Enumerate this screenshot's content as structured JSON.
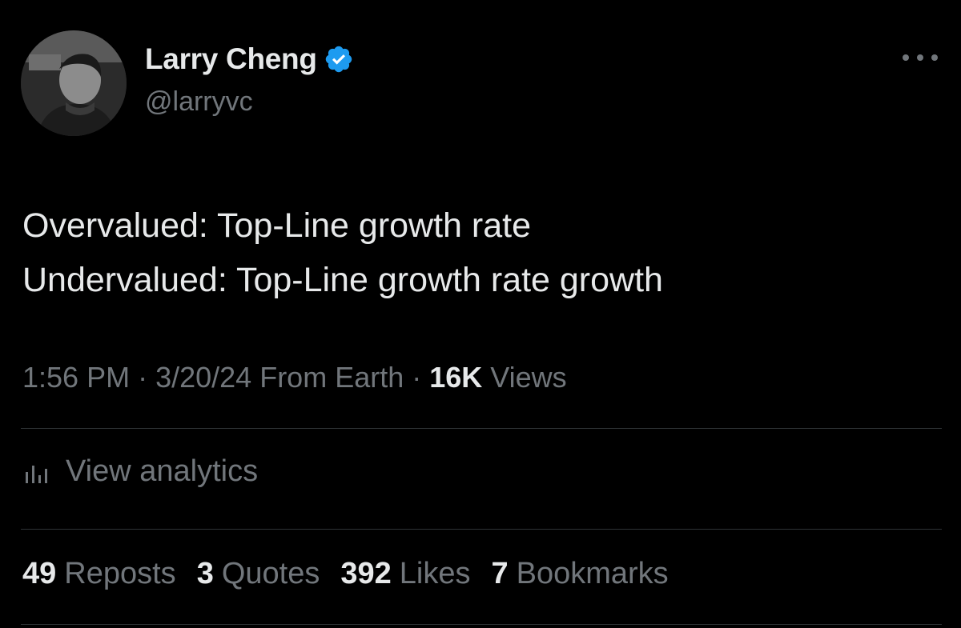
{
  "author": {
    "display_name": "Larry Cheng",
    "handle": "@larryvc",
    "verified": true,
    "verified_color": "#1d9bf0",
    "avatar_icon": "user-avatar-photo"
  },
  "tweet": {
    "lines": [
      "Overvalued: Top-Line growth rate",
      "Undervalued: Top-Line growth rate growth"
    ]
  },
  "meta": {
    "time": "1:56 PM",
    "date": "3/20/24",
    "location": "From Earth",
    "views_count": "16K",
    "views_label": "Views",
    "separator": "·"
  },
  "analytics": {
    "label": "View analytics",
    "icon": "bar-chart-icon"
  },
  "stats": [
    {
      "count": "49",
      "label": "Reposts"
    },
    {
      "count": "3",
      "label": "Quotes"
    },
    {
      "count": "392",
      "label": "Likes"
    },
    {
      "count": "7",
      "label": "Bookmarks"
    }
  ],
  "more_menu_icon": "more-horizontal-icon"
}
